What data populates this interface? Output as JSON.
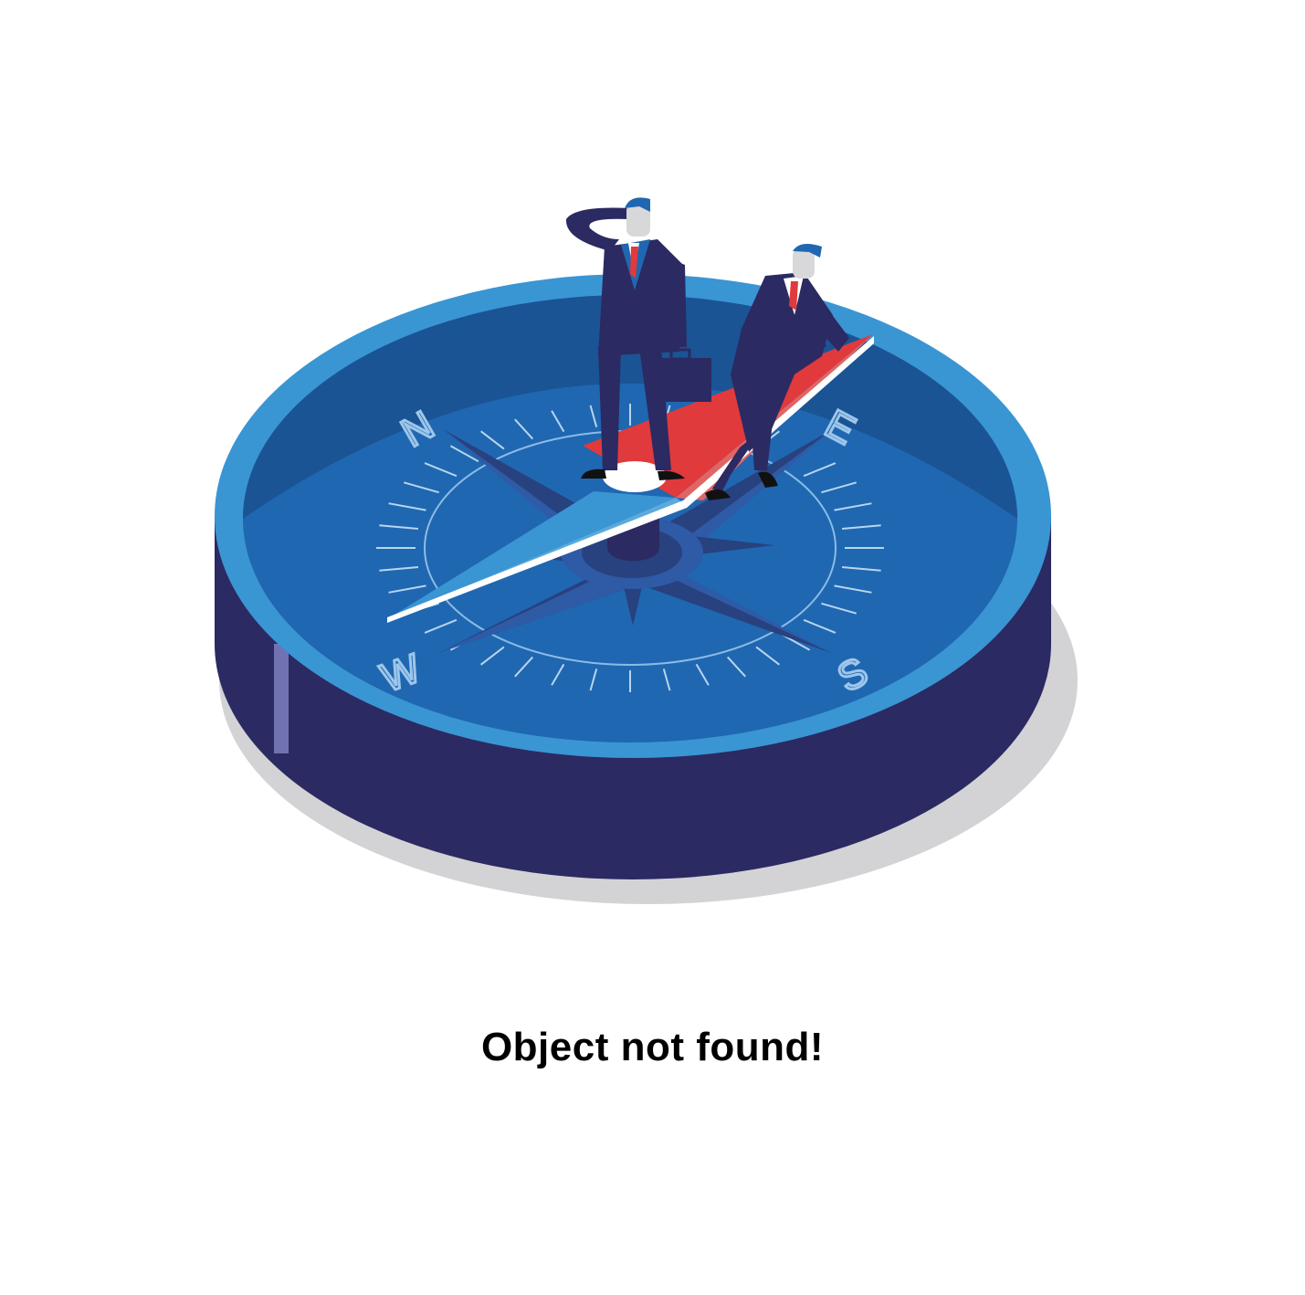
{
  "message": "Object not found!",
  "compass": {
    "north": "N",
    "east": "E",
    "south": "S",
    "west": "W"
  },
  "colors": {
    "background": "#ffffff",
    "rim": "#3a95d3",
    "face": "#1f67b1",
    "face_far": "#1a5494",
    "base": "#2b2a62",
    "shadow": "#d3d3d5",
    "needle_red": "#e03a3c",
    "needle_blue": "#5aaadd",
    "suit": "#2b2a62",
    "tie": "#e03a3c",
    "text": "#000000"
  }
}
